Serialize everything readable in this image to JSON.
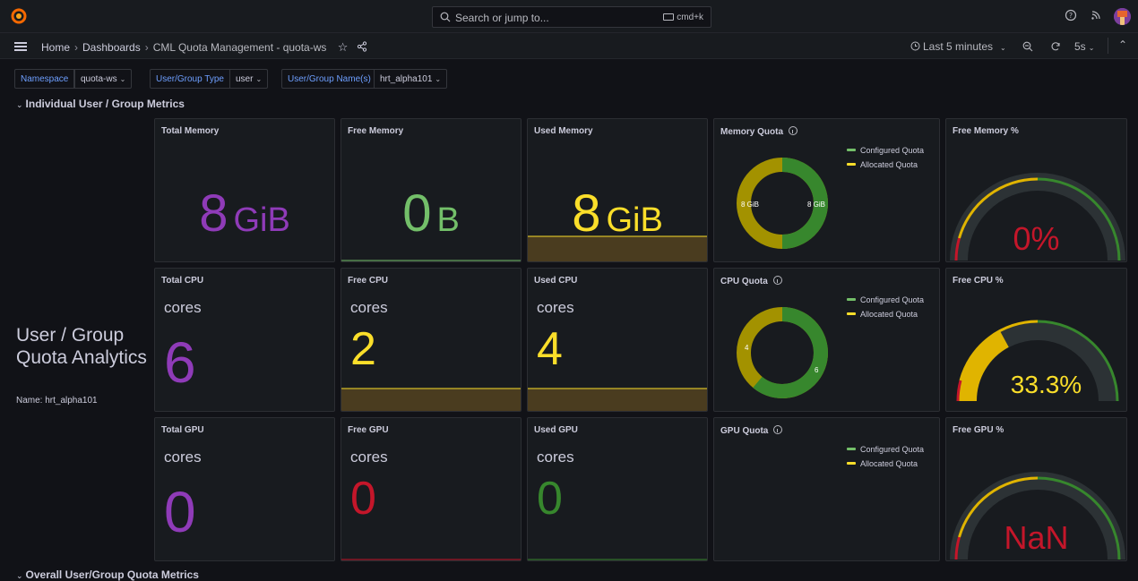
{
  "topbar": {
    "search_placeholder": "Search or jump to...",
    "shortcut": "cmd+k"
  },
  "navbar": {
    "breadcrumb": [
      "Home",
      "Dashboards",
      "CML Quota Management - quota-ws"
    ],
    "time_range": "Last 5 minutes",
    "refresh_interval": "5s"
  },
  "variables": [
    {
      "label": "Namespace",
      "value": "quota-ws"
    },
    {
      "label": "User/Group Type",
      "value": "user"
    },
    {
      "label": "User/Group Name(s)",
      "value": "hrt_alpha101"
    }
  ],
  "rows": {
    "individual": "Individual User / Group Metrics",
    "overall": "Overall User/Group Quota Metrics"
  },
  "left_panel": {
    "title": "User / Group Quota Analytics",
    "name_line": "Name: hrt_alpha101"
  },
  "memory": {
    "total": {
      "title": "Total Memory",
      "value": "8",
      "unit": "GiB"
    },
    "free": {
      "title": "Free Memory",
      "value": "0",
      "unit": "B"
    },
    "used": {
      "title": "Used Memory",
      "value": "8",
      "unit": "GiB"
    }
  },
  "cpu": {
    "total": {
      "title": "Total CPU",
      "unit": "cores",
      "value": "6"
    },
    "free": {
      "title": "Free CPU",
      "unit": "cores",
      "value": "2"
    },
    "used": {
      "title": "Used CPU",
      "unit": "cores",
      "value": "4"
    }
  },
  "gpu": {
    "total": {
      "title": "Total GPU",
      "unit": "cores",
      "value": "0"
    },
    "free": {
      "title": "Free GPU",
      "unit": "cores",
      "value": "0"
    },
    "used": {
      "title": "Used GPU",
      "unit": "cores",
      "value": "0"
    }
  },
  "quotas": {
    "memory": {
      "title": "Memory Quota",
      "configured_label": "8 GiB",
      "allocated_label": "8 GiB",
      "configured": 8,
      "allocated": 8
    },
    "cpu": {
      "title": "CPU Quota",
      "configured_label": "6",
      "allocated_label": "4",
      "configured": 6,
      "allocated": 4
    },
    "gpu": {
      "title": "GPU Quota"
    },
    "legend": {
      "configured": "Configured Quota",
      "allocated": "Allocated Quota"
    }
  },
  "gauges": {
    "memory": {
      "title": "Free Memory %",
      "value_text": "0%",
      "fraction": 0
    },
    "cpu": {
      "title": "Free CPU %",
      "value_text": "33.3%",
      "fraction": 0.333
    },
    "gpu": {
      "title": "Free GPU %",
      "value_text": "NaN",
      "fraction": 0
    }
  },
  "colors": {
    "purple": "#8f3bb8",
    "green": "#73bf69",
    "dark_green": "#37872d",
    "yellow": "#fade2a",
    "gold": "#e0b400",
    "olive": "#a39200",
    "red": "#c4162a",
    "track": "#2c3235",
    "accent_blue": "#6e9fff"
  }
}
